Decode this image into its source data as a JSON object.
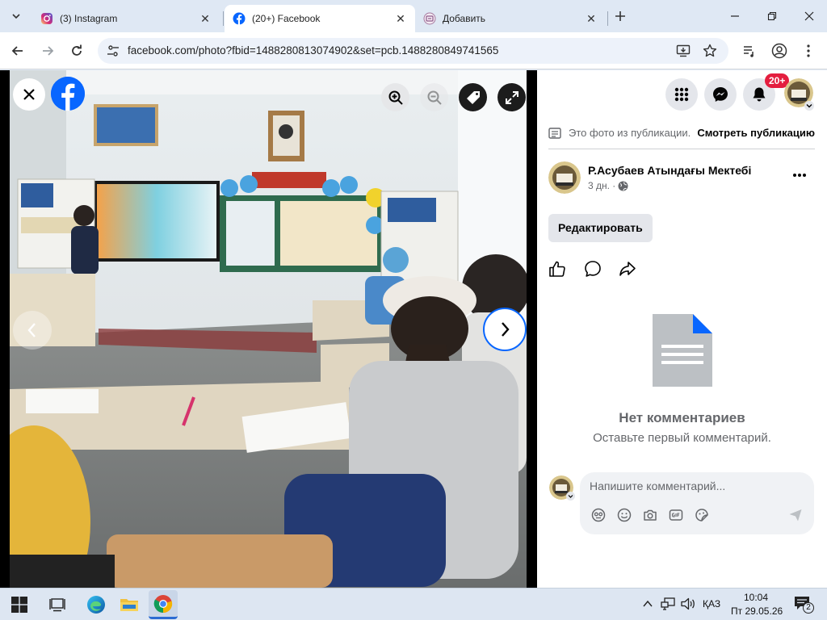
{
  "browser": {
    "tabs": [
      {
        "title": "(3) Instagram",
        "favicon": "instagram-icon",
        "active": false
      },
      {
        "title": "(20+) Facebook",
        "favicon": "facebook-icon",
        "active": true
      },
      {
        "title": "Добавить",
        "favicon": "add-page-icon",
        "active": false
      }
    ],
    "url": "facebook.com/photo?fbid=1488280813074902&set=pcb.1488280849741565"
  },
  "viewer": {
    "icons": [
      "close-icon",
      "facebook-logo-icon",
      "zoom-in-icon",
      "zoom-out-icon",
      "tag-icon",
      "fullscreen-icon",
      "prev-arrow-icon",
      "next-arrow-icon"
    ]
  },
  "panel": {
    "notification_badge": "20+",
    "publication_note": "Это фото из публикации.",
    "see_publication": "Смотреть публикацию",
    "author_name": "Р.Асубаев Атындағы Мектебі",
    "post_age": "3 дн. ·",
    "edit_button": "Редактировать",
    "no_comments_title": "Нет комментариев",
    "no_comments_subtitle": "Оставьте первый комментарий.",
    "comment_placeholder": "Напишите комментарий..."
  },
  "taskbar": {
    "language": "ҚАЗ",
    "time": "10:04",
    "date": "Пт 29.05.26",
    "notification_count": "2"
  },
  "colors": {
    "facebook_blue": "#0866ff",
    "badge_red": "#e41e3f",
    "tabstrip_bg": "#dfe8f4",
    "taskbar_bg": "#dde6f2"
  }
}
